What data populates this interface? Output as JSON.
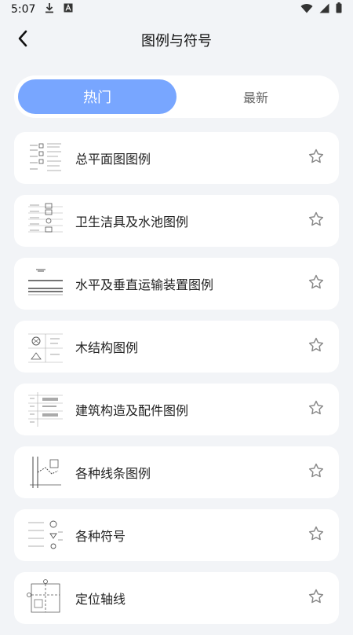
{
  "status_bar": {
    "time": "5:07",
    "icons": [
      "download-icon",
      "font-icon",
      "wifi-icon",
      "signal-icon",
      "battery-icon"
    ]
  },
  "header": {
    "title": "图例与符号",
    "back_icon": "chevron-left-icon"
  },
  "tabs": [
    {
      "label": "热门",
      "active": true
    },
    {
      "label": "最新",
      "active": false
    }
  ],
  "colors": {
    "accent": "#78a6ff",
    "background": "#f2f4f7",
    "card": "#ffffff"
  },
  "items": [
    {
      "label": "总平面图图例",
      "icon": "star-outline-icon"
    },
    {
      "label": "卫生洁具及水池图例",
      "icon": "star-outline-icon"
    },
    {
      "label": "水平及垂直运输装置图例",
      "icon": "star-outline-icon"
    },
    {
      "label": "木结构图例",
      "icon": "star-outline-icon"
    },
    {
      "label": "建筑构造及配件图例",
      "icon": "star-outline-icon"
    },
    {
      "label": "各种线条图例",
      "icon": "star-outline-icon"
    },
    {
      "label": "各种符号",
      "icon": "star-outline-icon"
    },
    {
      "label": "定位轴线",
      "icon": "star-outline-icon"
    }
  ]
}
